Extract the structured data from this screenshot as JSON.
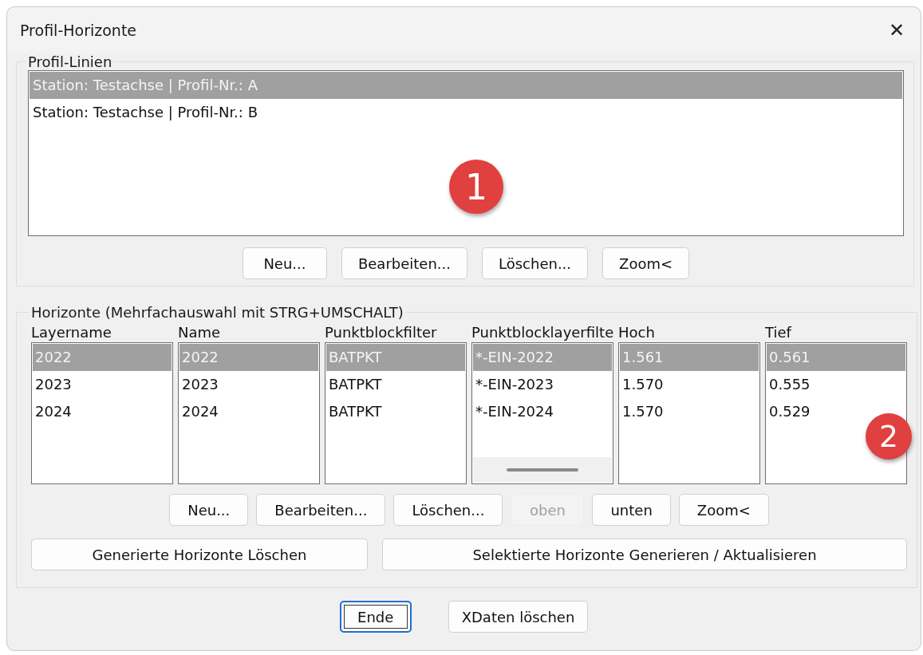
{
  "window": {
    "title": "Profil-Horizonte",
    "close": "✕"
  },
  "profile_lines": {
    "label": "Profil-Linien",
    "items": [
      {
        "text": "Station: Testachse | Profil-Nr.: A",
        "selected": true
      },
      {
        "text": "Station: Testachse | Profil-Nr.: B",
        "selected": false
      }
    ],
    "buttons": [
      {
        "label": "Neu...",
        "disabled": false
      },
      {
        "label": "Bearbeiten...",
        "disabled": false
      },
      {
        "label": "Löschen...",
        "disabled": false
      },
      {
        "label": "Zoom<",
        "disabled": false
      }
    ]
  },
  "horizons": {
    "label": "Horizonte (Mehrfachauswahl mit STRG+UMSCHALT)",
    "columns": [
      {
        "header": "Layername",
        "cells": [
          {
            "text": "2022",
            "selected": true
          },
          {
            "text": "2023",
            "selected": false
          },
          {
            "text": "2024",
            "selected": false
          }
        ]
      },
      {
        "header": "Name",
        "cells": [
          {
            "text": "2022",
            "selected": true
          },
          {
            "text": "2023",
            "selected": false
          },
          {
            "text": "2024",
            "selected": false
          }
        ]
      },
      {
        "header": "Punktblockfilter",
        "cells": [
          {
            "text": "BATPKT",
            "selected": true
          },
          {
            "text": "BATPKT",
            "selected": false
          },
          {
            "text": "BATPKT",
            "selected": false
          }
        ]
      },
      {
        "header": "Punktblocklayerfilte",
        "horizontal_scrollbar": true,
        "cells": [
          {
            "text": "*-EIN-2022",
            "selected": true
          },
          {
            "text": "*-EIN-2023",
            "selected": false
          },
          {
            "text": "*-EIN-2024",
            "selected": false
          }
        ]
      },
      {
        "header": "Hoch",
        "cells": [
          {
            "text": "1.561",
            "selected": true
          },
          {
            "text": "1.570",
            "selected": false
          },
          {
            "text": "1.570",
            "selected": false
          }
        ]
      },
      {
        "header": "Tief",
        "cells": [
          {
            "text": "0.561",
            "selected": true
          },
          {
            "text": "0.555",
            "selected": false
          },
          {
            "text": "0.529",
            "selected": false
          }
        ]
      }
    ],
    "buttons": [
      {
        "label": "Neu...",
        "disabled": false
      },
      {
        "label": "Bearbeiten...",
        "disabled": false
      },
      {
        "label": "Löschen...",
        "disabled": false
      },
      {
        "label": "oben",
        "disabled": true
      },
      {
        "label": "unten",
        "disabled": false
      },
      {
        "label": "Zoom<",
        "disabled": false
      }
    ],
    "wide_buttons": [
      {
        "label": "Generierte Horizonte Löschen"
      },
      {
        "label": "Selektierte Horizonte Generieren / Aktualisieren"
      }
    ]
  },
  "footer_buttons": [
    {
      "label": "Ende",
      "focused": true
    },
    {
      "label": "XDaten löschen",
      "focused": false
    }
  ],
  "markers": [
    "1",
    "2"
  ]
}
